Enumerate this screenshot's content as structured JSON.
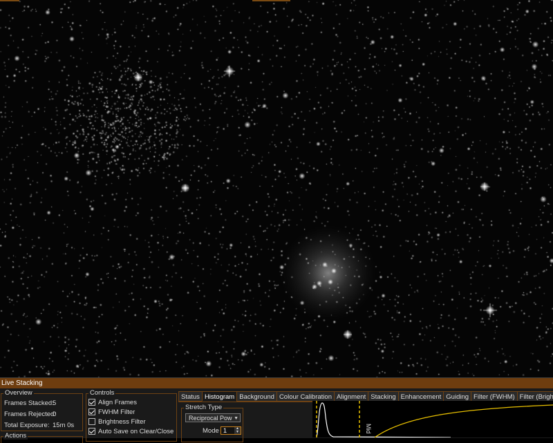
{
  "window": {
    "panel_title": "Live Stacking"
  },
  "overview": {
    "title": "Overview",
    "stats": [
      {
        "label": "Frames Stacked:",
        "value": "5"
      },
      {
        "label": "Frames Rejected:",
        "value": "0"
      },
      {
        "label": "Total Exposure:",
        "value": "15m 0s"
      }
    ]
  },
  "actions": {
    "title": "Actions"
  },
  "controls": {
    "title": "Controls",
    "items": [
      {
        "label": "Align Frames",
        "checked": true
      },
      {
        "label": "FWHM Filter",
        "checked": true
      },
      {
        "label": "Brightness Filter",
        "checked": false
      },
      {
        "label": "Auto Save on Clear/Close",
        "checked": true
      }
    ]
  },
  "tabs": [
    {
      "label": "Status",
      "active": false
    },
    {
      "label": "Histogram",
      "active": true
    },
    {
      "label": "Background",
      "active": false
    },
    {
      "label": "Colour Calibration",
      "active": false
    },
    {
      "label": "Alignment",
      "active": false
    },
    {
      "label": "Stacking",
      "active": false
    },
    {
      "label": "Enhancement",
      "active": false
    },
    {
      "label": "Guiding",
      "active": false
    },
    {
      "label": "Filter (FWHM)",
      "active": false
    },
    {
      "label": "Filter (Brightne",
      "active": false
    }
  ],
  "histogram": {
    "stretch_type_title": "Stretch Type",
    "stretch_type_value": "Reciprocal Pow",
    "mode_label": "Mode",
    "mode_value": "1",
    "mid_label": "Mid",
    "colors": {
      "curve": "#e8c000",
      "markers": "#e8c000",
      "histogram": "#ffffff"
    }
  },
  "colors": {
    "accent": "#6e3d0f",
    "border": "#6e4214"
  }
}
